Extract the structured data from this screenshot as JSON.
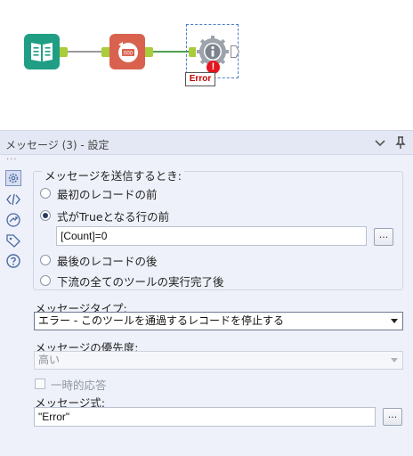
{
  "canvas": {
    "error_label": "Error",
    "error_badge": "!",
    "input_tool_icon": "book-icon",
    "formula_tool_icon": "counter-icon",
    "formula_tool_text": "000",
    "message_tool_icon": "info-gear-icon",
    "colors": {
      "input_tool": "#1f9e84",
      "formula_tool": "#d9624f",
      "anchor": "#a9cc3b",
      "error": "#e4151f"
    }
  },
  "panel": {
    "title": "メッセージ (3) - 設定",
    "when_title": "メッセージを送信するとき:",
    "options": {
      "first_record": "最初のレコードの前",
      "expression_true": "式がTrueとなる行の前",
      "last_record": "最後のレコードの後",
      "after_downstream": "下流の全てのツールの実行完了後"
    },
    "selected_option": "expression_true",
    "expression_value": "[Count]=0",
    "dots_label": "...",
    "message_type_label": "メッセージタイプ:",
    "message_type_value": "エラー - このツールを通過するレコードを停止する",
    "priority_label": "メッセージの優先度:",
    "priority_value": "高い",
    "transient_label": "一時的応答",
    "message_expr_label": "メッセージ式:",
    "message_expr_value": "\"Error\"",
    "side_icons": [
      "config-gear-icon",
      "xml-code-icon",
      "connection-icon",
      "annotation-tag-icon",
      "help-icon"
    ]
  }
}
